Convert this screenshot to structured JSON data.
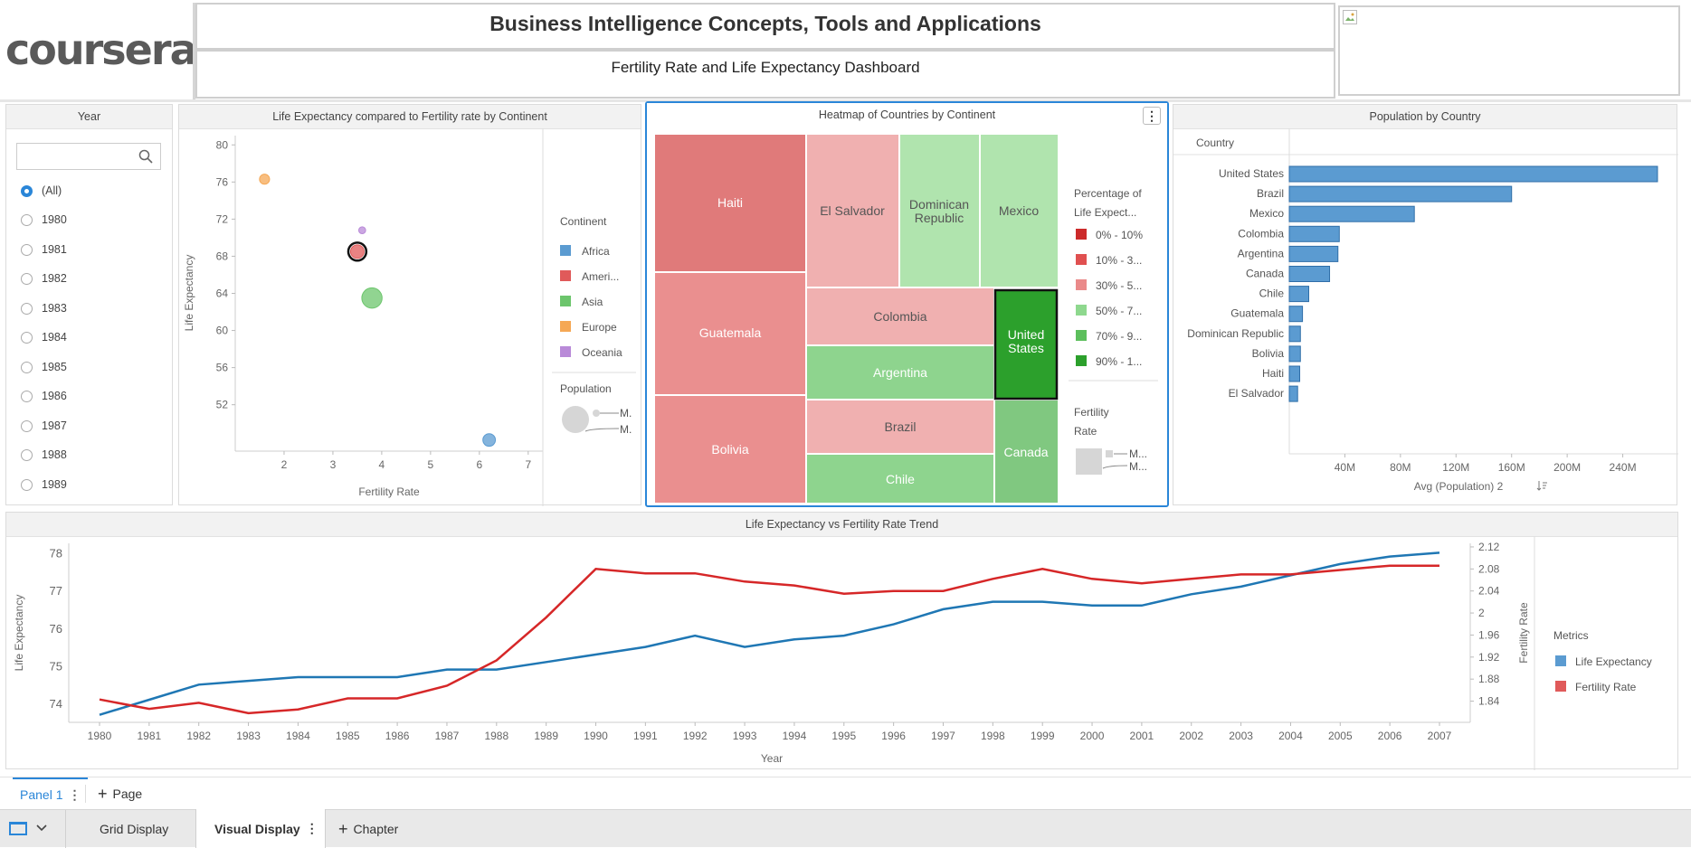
{
  "header": {
    "logo_text": "coursera",
    "course_title": "Business Intelligence Concepts, Tools and Applications",
    "dashboard_title": "Fertility Rate and Life Expectancy Dashboard"
  },
  "colors": {
    "africa": "#5b9bd1",
    "americas": "#e05a5a",
    "asia": "#6cc56c",
    "europe": "#f5a855",
    "oceania": "#b98ad8",
    "accent_blue": "#2a86d8",
    "life_expectancy_line": "#1f77b4",
    "fertility_line": "#d62728"
  },
  "year_filter": {
    "title": "Year",
    "search_placeholder": "",
    "selected": "(All)",
    "options": [
      "(All)",
      "1980",
      "1981",
      "1982",
      "1983",
      "1984",
      "1985",
      "1986",
      "1987",
      "1988",
      "1989"
    ]
  },
  "scatter": {
    "title": "Life Expectancy compared to Fertility rate by Continent",
    "legend_title": "Continent",
    "legend": [
      "Africa",
      "Ameri...",
      "Asia",
      "Europe",
      "Oceania"
    ],
    "size_legend_title": "Population",
    "size_legend_labels": [
      "M.",
      "M."
    ]
  },
  "heatmap": {
    "title": "Heatmap of Countries by Continent",
    "menu_icon": "more-vertical-icon",
    "legend_title": "Percentage of Life Expect...",
    "legend_title_line1": "Percentage of",
    "legend_title_line2": "Life Expect...",
    "legend": [
      "0% - 10%",
      "10% - 3...",
      "30% - 5...",
      "50% - 7...",
      "70% - 9...",
      "90% - 1..."
    ],
    "legend_colors": [
      "#cc2a2a",
      "#e05050",
      "#ea8a8a",
      "#8ed88e",
      "#5cbf5c",
      "#2ca02c"
    ],
    "size_legend_title": "Fertility Rate",
    "size_legend_line1": "Fertility",
    "size_legend_line2": "Rate",
    "size_legend_labels": [
      "M...",
      "M..."
    ],
    "cells": {
      "haiti": "Haiti",
      "guatemala": "Guatemala",
      "bolivia": "Bolivia",
      "el_salvador": "El Salvador",
      "dominican_republic_1": "Dominican",
      "dominican_republic_2": "Republic",
      "mexico": "Mexico",
      "colombia": "Colombia",
      "united_states_1": "United",
      "united_states_2": "States",
      "argentina": "Argentina",
      "brazil": "Brazil",
      "canada": "Canada",
      "chile": "Chile"
    }
  },
  "population": {
    "title": "Population by Country",
    "column_header": "Country",
    "xlabel": "Avg (Population) 2",
    "sort_icon": "sort-icon"
  },
  "trend": {
    "title": "Life Expectancy vs Fertility Rate Trend",
    "legend_title": "Metrics",
    "legend": [
      "Life Expectancy",
      "Fertility Rate"
    ]
  },
  "chart_data": [
    {
      "type": "scatter",
      "title": "Life Expectancy compared to Fertility rate by Continent",
      "xlabel": "Fertility Rate",
      "ylabel": "Life Expectancy",
      "xlim": [
        1,
        7.3
      ],
      "ylim": [
        47,
        81
      ],
      "xticks": [
        2,
        3,
        4,
        5,
        6,
        7
      ],
      "yticks": [
        52,
        56,
        60,
        64,
        68,
        72,
        76,
        80
      ],
      "grid": false,
      "legend_position": "right",
      "points": [
        {
          "continent": "Europe",
          "x": 1.6,
          "y": 76.3,
          "size": 1.3,
          "color": "#f5a855"
        },
        {
          "continent": "Oceania",
          "x": 3.6,
          "y": 70.8,
          "size": 0.5,
          "color": "#b98ad8"
        },
        {
          "continent": "Americas",
          "x": 3.5,
          "y": 68.5,
          "size": 2.6,
          "color": "#e05a5a",
          "selected": true
        },
        {
          "continent": "Asia",
          "x": 3.8,
          "y": 63.5,
          "size": 6.5,
          "color": "#6cc56c"
        },
        {
          "continent": "Africa",
          "x": 6.2,
          "y": 48.2,
          "size": 2.2,
          "color": "#5b9bd1"
        }
      ]
    },
    {
      "type": "bar",
      "title": "Population by Country",
      "xlabel": "Avg (Population) 2",
      "ylabel": "Country",
      "orientation": "horizontal",
      "xlim": [
        0,
        280000000
      ],
      "xticks": [
        "40M",
        "80M",
        "120M",
        "160M",
        "200M",
        "240M"
      ],
      "xtick_values": [
        40000000,
        80000000,
        120000000,
        160000000,
        200000000,
        240000000
      ],
      "categories": [
        "United States",
        "Brazil",
        "Mexico",
        "Colombia",
        "Argentina",
        "Canada",
        "Chile",
        "Guatemala",
        "Dominican Republic",
        "Bolivia",
        "Haiti",
        "El Salvador"
      ],
      "values": [
        265000000,
        160000000,
        90000000,
        36000000,
        35000000,
        29000000,
        14000000,
        9500000,
        8000000,
        8000000,
        7500000,
        6000000
      ]
    },
    {
      "type": "line",
      "title": "Life Expectancy vs Fertility Rate Trend",
      "xlabel": "Year",
      "ylabel": "Life Expectancy",
      "y2label": "Fertility Rate",
      "x": [
        "1980",
        "1981",
        "1982",
        "1983",
        "1984",
        "1985",
        "1986",
        "1987",
        "1988",
        "1989",
        "1990",
        "1991",
        "1992",
        "1993",
        "1994",
        "1995",
        "1996",
        "1997",
        "1998",
        "1999",
        "2000",
        "2001",
        "2002",
        "2003",
        "2004",
        "2005",
        "2006",
        "2007"
      ],
      "ylim": [
        73.5,
        78.25
      ],
      "y2lim": [
        1.8015,
        2.1265
      ],
      "yticks": [
        74,
        75,
        76,
        77,
        78
      ],
      "y2ticks": [
        1.84,
        1.88,
        1.92,
        1.96,
        2,
        2.04,
        2.08,
        2.12
      ],
      "legend_position": "right",
      "series": [
        {
          "name": "Life Expectancy",
          "axis": "left",
          "color": "#1f77b4",
          "values": [
            73.7,
            74.1,
            74.5,
            74.6,
            74.7,
            74.7,
            74.7,
            74.9,
            74.9,
            75.1,
            75.3,
            75.5,
            75.8,
            75.5,
            75.7,
            75.8,
            76.1,
            76.5,
            76.7,
            76.7,
            76.6,
            76.6,
            76.9,
            77.1,
            77.4,
            77.7,
            77.9,
            78.0
          ]
        },
        {
          "name": "Fertility Rate",
          "axis": "right",
          "color": "#d62728",
          "values": [
            1.843,
            1.826,
            1.837,
            1.818,
            1.825,
            1.845,
            1.845,
            1.868,
            1.914,
            1.992,
            2.08,
            2.072,
            2.072,
            2.057,
            2.05,
            2.035,
            2.04,
            2.04,
            2.062,
            2.08,
            2.062,
            2.054,
            2.062,
            2.07,
            2.07,
            2.078,
            2.086,
            2.086
          ]
        }
      ]
    }
  ],
  "bottom": {
    "panel_tab": "Panel 1",
    "add_page": "Page",
    "grid_tab": "Grid Display",
    "visual_tab": "Visual Display",
    "add_chapter": "Chapter"
  }
}
